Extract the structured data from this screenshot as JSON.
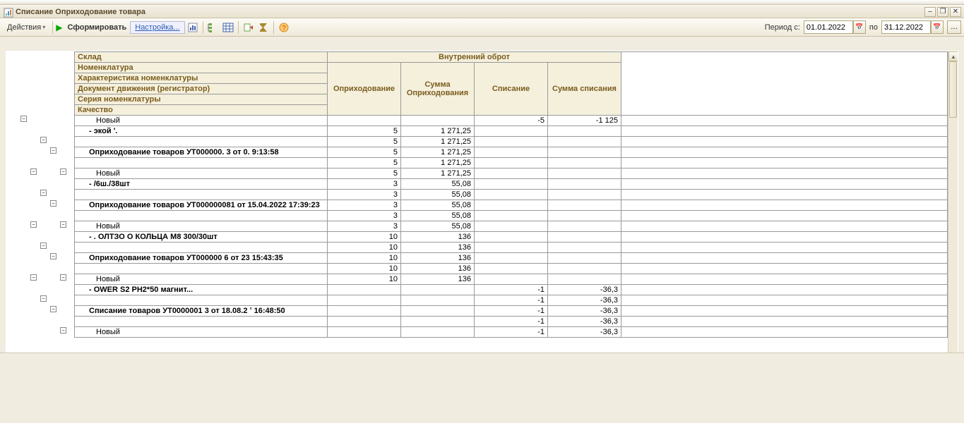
{
  "window": {
    "title": "Списание Оприходование товара"
  },
  "toolbar": {
    "actions_label": "Действия",
    "generate_label": "Сформировать",
    "settings_label": "Настройка...",
    "period_from_label": "Период с:",
    "period_to_label": "по",
    "date_from": "01.01.2022",
    "date_to": "31.12.2022"
  },
  "grid": {
    "header_rows": [
      "Склад",
      "Номенклатура",
      "Характеристика номенклатуры",
      "Документ движения (регистратор)",
      "Серия номенклатуры",
      "Качество"
    ],
    "header_group": "Внутренний оброт",
    "cols": [
      "Оприходование",
      "Сумма Оприходования",
      "Списание",
      "Сумма списания"
    ],
    "rows": [
      {
        "name": "Новый",
        "indent": 2,
        "c1": "",
        "c2": "",
        "c3": "-5",
        "c4": "-1 125"
      },
      {
        "name": "-                                                            экой      '.",
        "indent": 1,
        "bold": true,
        "c1": "5",
        "c2": "1 271,25",
        "c3": "",
        "c4": ""
      },
      {
        "name": "",
        "indent": 0,
        "c1": "5",
        "c2": "1 271,25",
        "c3": "",
        "c4": ""
      },
      {
        "name": "Оприходование товаров УТ000000.  3 от 0.                9:13:58",
        "indent": 1,
        "bold": true,
        "c1": "5",
        "c2": "1 271,25",
        "c3": "",
        "c4": ""
      },
      {
        "name": "",
        "indent": 0,
        "c1": "5",
        "c2": "1 271,25",
        "c3": "",
        "c4": ""
      },
      {
        "name": "Новый",
        "indent": 2,
        "c1": "5",
        "c2": "1 271,25",
        "c3": "",
        "c4": ""
      },
      {
        "name": "-                                      /6ш./38шт",
        "indent": 1,
        "bold": true,
        "c1": "3",
        "c2": "55,08",
        "c3": "",
        "c4": ""
      },
      {
        "name": "",
        "indent": 0,
        "c1": "3",
        "c2": "55,08",
        "c3": "",
        "c4": ""
      },
      {
        "name": "Оприходование товаров УТ000000081 от 15.04.2022 17:39:23",
        "indent": 1,
        "bold": true,
        "c1": "3",
        "c2": "55,08",
        "c3": "",
        "c4": ""
      },
      {
        "name": "",
        "indent": 0,
        "c1": "3",
        "c2": "55,08",
        "c3": "",
        "c4": ""
      },
      {
        "name": "Новый",
        "indent": 2,
        "c1": "3",
        "c2": "55,08",
        "c3": "",
        "c4": ""
      },
      {
        "name": "-       .  ОЛТЗО О КОЛЬЦА    М8 300/30шт",
        "indent": 1,
        "bold": true,
        "c1": "10",
        "c2": "136",
        "c3": "",
        "c4": ""
      },
      {
        "name": "",
        "indent": 0,
        "c1": "10",
        "c2": "136",
        "c3": "",
        "c4": ""
      },
      {
        "name": "Оприходование товаров УТ000000  6    от 23              15:43:35",
        "indent": 1,
        "bold": true,
        "c1": "10",
        "c2": "136",
        "c3": "",
        "c4": ""
      },
      {
        "name": "",
        "indent": 0,
        "c1": "10",
        "c2": "136",
        "c3": "",
        "c4": ""
      },
      {
        "name": "Новый",
        "indent": 2,
        "c1": "10",
        "c2": "136",
        "c3": "",
        "c4": ""
      },
      {
        "name": "-           OWER S2 PH2*50 магнит...",
        "indent": 1,
        "bold": true,
        "c1": "",
        "c2": "",
        "c3": "-1",
        "c4": "-36,3"
      },
      {
        "name": "",
        "indent": 0,
        "c1": "",
        "c2": "",
        "c3": "-1",
        "c4": "-36,3"
      },
      {
        "name": "Списание товаров УТ0000001  3 от 18.08.2    ʼ 16:48:50",
        "indent": 1,
        "bold": true,
        "c1": "",
        "c2": "",
        "c3": "-1",
        "c4": "-36,3"
      },
      {
        "name": "",
        "indent": 0,
        "c1": "",
        "c2": "",
        "c3": "-1",
        "c4": "-36,3"
      },
      {
        "name": "Новый",
        "indent": 2,
        "c1": "",
        "c2": "",
        "c3": "-1",
        "c4": "-36,3"
      }
    ]
  },
  "tree": {
    "nodes": [
      {
        "row": 1,
        "depth": 1,
        "sym": "−"
      },
      {
        "row": 3,
        "depth": 3,
        "sym": "−"
      },
      {
        "row": 4,
        "depth": 4,
        "sym": "−"
      },
      {
        "row": 6,
        "depth": 2,
        "sym": "−"
      },
      {
        "row": 6,
        "depth": 5,
        "sym": "−"
      },
      {
        "row": 8,
        "depth": 3,
        "sym": "−"
      },
      {
        "row": 9,
        "depth": 4,
        "sym": "−"
      },
      {
        "row": 11,
        "depth": 2,
        "sym": "−"
      },
      {
        "row": 11,
        "depth": 5,
        "sym": "−"
      },
      {
        "row": 13,
        "depth": 3,
        "sym": "−"
      },
      {
        "row": 14,
        "depth": 4,
        "sym": "−"
      },
      {
        "row": 16,
        "depth": 2,
        "sym": "−"
      },
      {
        "row": 16,
        "depth": 5,
        "sym": "−"
      },
      {
        "row": 18,
        "depth": 3,
        "sym": "−"
      },
      {
        "row": 19,
        "depth": 4,
        "sym": "−"
      },
      {
        "row": 21,
        "depth": 5,
        "sym": "−"
      }
    ]
  }
}
